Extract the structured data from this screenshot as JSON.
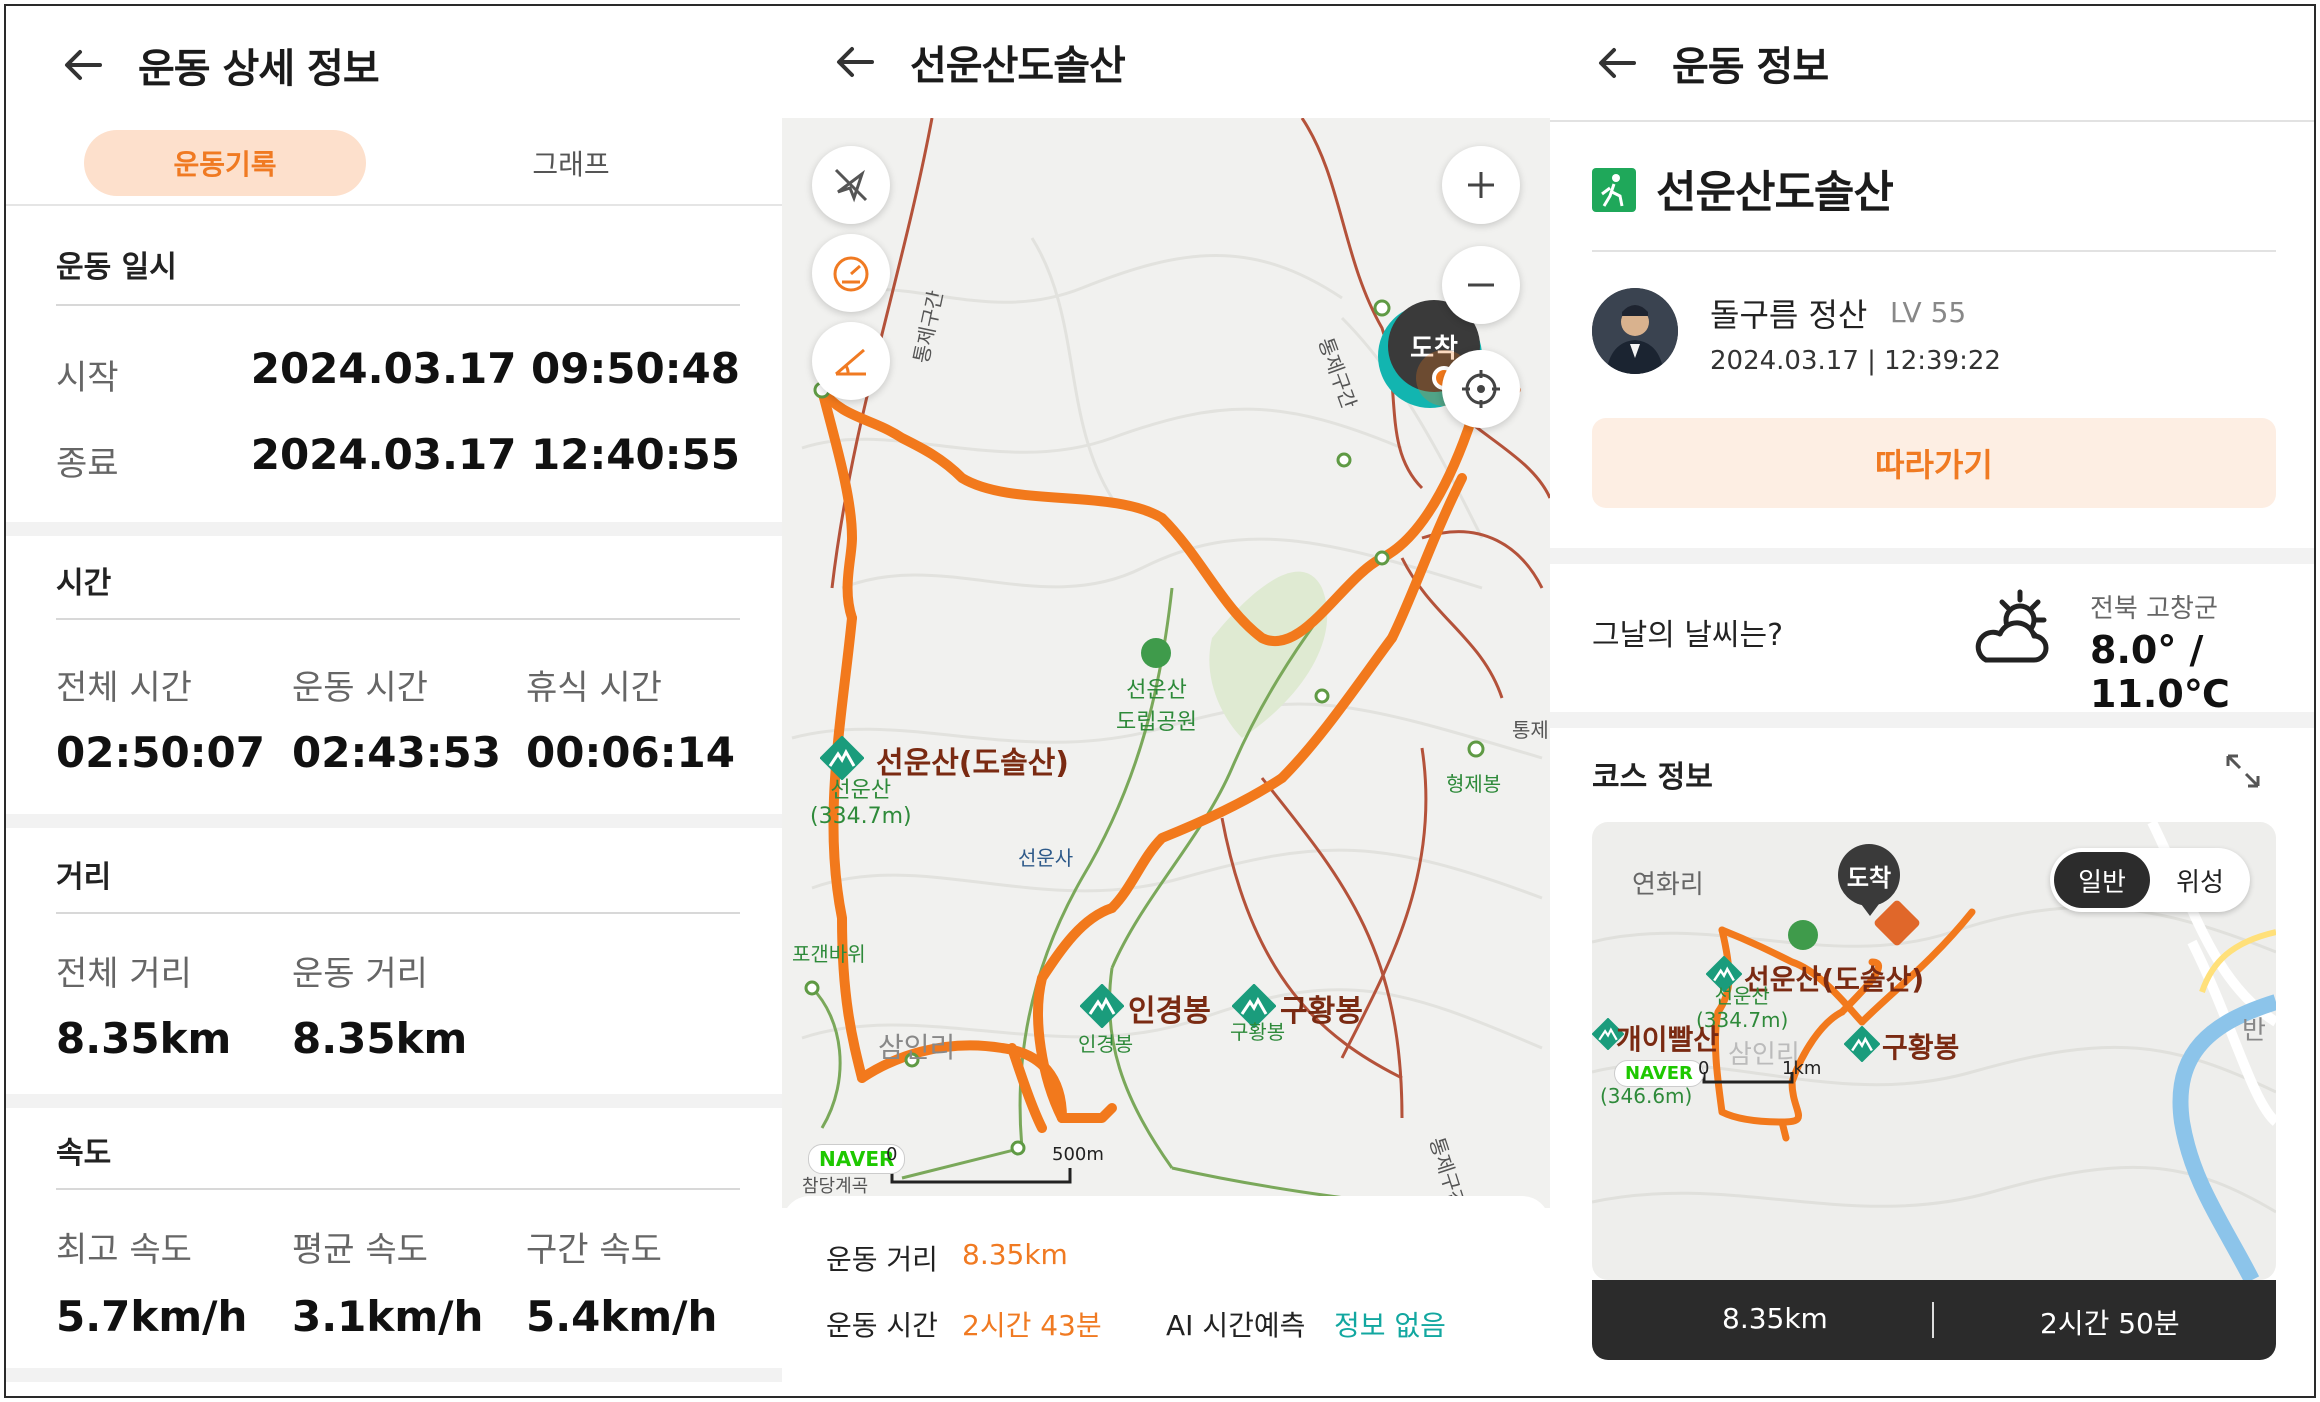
{
  "panel1": {
    "header_title": "운동 상세 정보",
    "tabs": [
      "운동기록",
      "그래프"
    ],
    "datetime": {
      "title": "운동 일시",
      "start_label": "시작",
      "start_value": "2024.03.17 09:50:48",
      "end_label": "종료",
      "end_value": "2024.03.17 12:40:55"
    },
    "time": {
      "title": "시간",
      "cells": [
        {
          "label": "전체 시간",
          "value": "02:50:07"
        },
        {
          "label": "운동 시간",
          "value": "02:43:53"
        },
        {
          "label": "휴식 시간",
          "value": "00:06:14"
        }
      ]
    },
    "distance": {
      "title": "거리",
      "cells": [
        {
          "label": "전체 거리",
          "value": "8.35km"
        },
        {
          "label": "운동 거리",
          "value": "8.35km"
        }
      ]
    },
    "speed": {
      "title": "속도",
      "cells": [
        {
          "label": "최고 속도",
          "value": "5.7km/h"
        },
        {
          "label": "평균 속도",
          "value": "3.1km/h"
        },
        {
          "label": "구간 속도",
          "value": "5.4km/h"
        }
      ]
    }
  },
  "panel2": {
    "header_title": "선운산도솔산",
    "map": {
      "arrival_label": "도착",
      "labels": {
        "peak_main": "선운산(도솔산)",
        "peak_main_sub1": "선운산",
        "peak_main_sub2": "(334.7m)",
        "park1": "선운산",
        "park2": "도립공원",
        "temple": "선운사",
        "inkyeong": "인경봉",
        "inkyeong_sub": "인경봉",
        "guhwang": "구황봉",
        "guhwang_sub": "구황봉",
        "hyeongje": "형제봉",
        "samin": "삼인리",
        "pogae": "포갠바위",
        "road1": "통제구간",
        "road2": "통제구간",
        "road3": "통제",
        "road4": "통제구간",
        "chambang": "참당계곡"
      },
      "naver": "NAVER",
      "scale_zero": "0",
      "scale_label": "500m",
      "controls": [
        "compass-off",
        "speed",
        "slope",
        "zoom-in",
        "zoom-out",
        "locate"
      ]
    },
    "summary": {
      "dist_label": "운동 거리",
      "dist_value": "8.35km",
      "time_label": "운동 시간",
      "time_value": "2시간 43분",
      "ai_label": "AI 시간예측",
      "ai_value": "정보 없음"
    }
  },
  "panel3": {
    "header_title": "운동 정보",
    "course_title": "선운산도솔산",
    "user_name": "돌구름 정산",
    "user_level": "LV 55",
    "user_date": "2024.03.17 | 12:39:22",
    "follow_label": "따라가기",
    "weather_question": "그날의 날씨는?",
    "weather_region": "전북 고창군",
    "weather_temp": "8.0° / 11.0℃",
    "course_info_title": "코스 정보",
    "minimap": {
      "arrival_label": "도착",
      "mode_on": "일반",
      "mode_off": "위성",
      "labels": {
        "yeonhwa": "연화리",
        "peak_main": "선운산(도솔산)",
        "peak_sub1": "선운산",
        "peak_sub2": "(334.7m)",
        "gaeippal": "개이빨산",
        "gaeippal_sub": "(346.6m)",
        "guhwang": "구황봉",
        "samin": "삼인리",
        "ban": "반"
      },
      "naver": "NAVER",
      "scale_zero": "0",
      "scale_label": "1km",
      "dist": "8.35km",
      "time": "2시간 50분"
    }
  },
  "colors": {
    "accent": "#f07a22",
    "route": "#f2791c",
    "teal": "#12a7a0",
    "peak_green": "#1a9c7c",
    "label_brown": "#7a2a12"
  }
}
